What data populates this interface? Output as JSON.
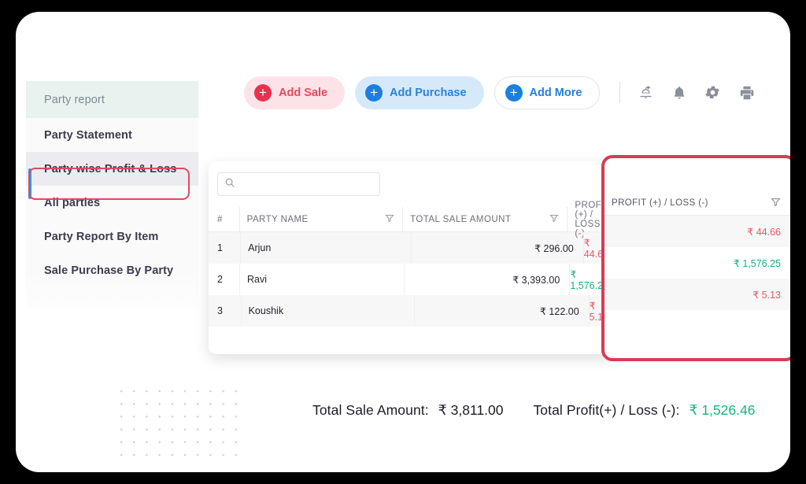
{
  "sidebar": {
    "header": "Party report",
    "items": [
      {
        "label": "Party Statement",
        "selected": false
      },
      {
        "label": "Party wise Profit & Loss",
        "selected": true
      },
      {
        "label": "All parties",
        "selected": false
      },
      {
        "label": "Party Report By Item",
        "selected": false
      },
      {
        "label": "Sale Purchase By Party",
        "selected": false
      }
    ]
  },
  "toolbar": {
    "add_sale_label": "Add Sale",
    "add_purchase_label": "Add Purchase",
    "add_more_label": "Add More",
    "plus_glyph": "+",
    "icons": [
      {
        "name": "share-export-icon"
      },
      {
        "name": "bell-icon"
      },
      {
        "name": "gear-icon"
      },
      {
        "name": "printer-icon"
      }
    ]
  },
  "search": {
    "value": "",
    "placeholder": ""
  },
  "table": {
    "columns": [
      "#",
      "PARTY NAME",
      "TOTAL SALE AMOUNT",
      "PROFIT (+) / LOSS (-)"
    ],
    "rows": [
      {
        "num": "1",
        "party": "Arjun",
        "sale": "₹ 296.00",
        "pl": "₹ 44.66",
        "pl_type": "loss"
      },
      {
        "num": "2",
        "party": "Ravi",
        "sale": "₹ 3,393.00",
        "pl": "₹ 1,576.25",
        "pl_type": "profit"
      },
      {
        "num": "3",
        "party": "Koushik",
        "sale": "₹ 122.00",
        "pl": "₹ 5.13",
        "pl_type": "loss"
      }
    ]
  },
  "totals": {
    "sale_label": "Total Sale Amount:",
    "sale_value": "₹ 3,811.00",
    "pl_label": "Total Profit(+) / Loss (-):",
    "pl_value": "₹ 1,526.46"
  },
  "colors": {
    "sale_accent": "#e8314f",
    "purchase_accent": "#1a7fe0",
    "highlight_border": "#d93a55",
    "profit": "#17b57c",
    "loss": "#ee5565",
    "selected_bar": "#2f9be3"
  }
}
